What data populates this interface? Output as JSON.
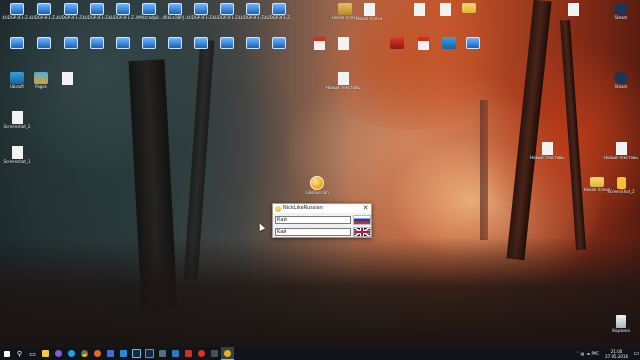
{
  "desktop": {
    "row1": [
      "4UDGP3F1-Z...",
      "4UDGP3F1-Z...",
      "4UDGP3F1-Z...",
      "4UDGP3F1-Z...",
      "4UDGP3F1-Z...",
      "4MVzcadp8...",
      "4RkLsOBPJ...",
      "4UDGP3F1-Z...",
      "4UDGP3F1-Z...",
      "4UDGP3F1-Z...",
      "4UDGP3F1-Z..."
    ],
    "row2": [
      "",
      "",
      "",
      "",
      "",
      "",
      "",
      "",
      "",
      "",
      ""
    ],
    "left_col": [
      "Ubisoft",
      "Pages",
      "Screenshot_2",
      "Screenshot_1"
    ],
    "mid_top": [
      "Новая папка",
      "Новая папка",
      "",
      "",
      ""
    ],
    "mid_row2": [
      "",
      "",
      "",
      "",
      ""
    ],
    "mid_doc": "Новый текстовый",
    "right_col": [
      "",
      "Steam",
      "Steam",
      "Новый текстовый",
      "Новый текстовый",
      "Новая папка",
      "ScreenShot_2"
    ],
    "recycle_bin": "Корзина",
    "app_shortcut": "LikeRussian"
  },
  "window": {
    "title": "NickLikeRussian",
    "input_top": "Кай",
    "input_bottom": "Kaй",
    "flag_top": "russian-flag",
    "flag_bottom": "uk-flag"
  },
  "taskbar": {
    "tray_lang": "РУС",
    "time": "21:00",
    "date": "27.05.2016"
  },
  "colors": {
    "accent": "#7fb3ff",
    "taskbar": "#101418",
    "window_bg": "#f0f0f0"
  }
}
